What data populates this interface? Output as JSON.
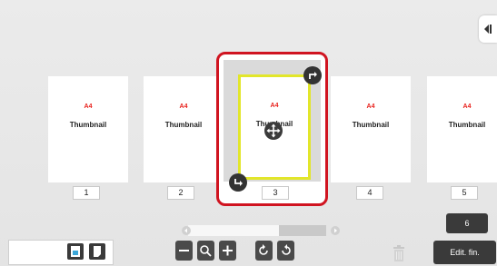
{
  "pages": [
    {
      "size": "A4",
      "label": "Thumbnail",
      "number": "1"
    },
    {
      "size": "A4",
      "label": "Thumbnail",
      "number": "2"
    },
    {
      "size": "A4",
      "label": "Thumbnail",
      "number": "3",
      "selected": true
    },
    {
      "size": "A4",
      "label": "Thumbnail",
      "number": "4"
    },
    {
      "size": "A4",
      "label": "Thumbnail",
      "number": "5"
    }
  ],
  "extra_page_number": "6",
  "toolbar": {
    "icons": [
      "zoom-out-icon",
      "zoom-icon",
      "zoom-in-icon",
      "rotate-left-icon",
      "rotate-right-icon"
    ],
    "edit_finish_label": "Edit. fin."
  },
  "scroll": {
    "position_fraction": 0.66
  },
  "colors": {
    "selection_border": "#d01420",
    "page_frame": "#e2e62a",
    "size_text": "#e8201b",
    "button_dark": "#3a3a3a"
  }
}
